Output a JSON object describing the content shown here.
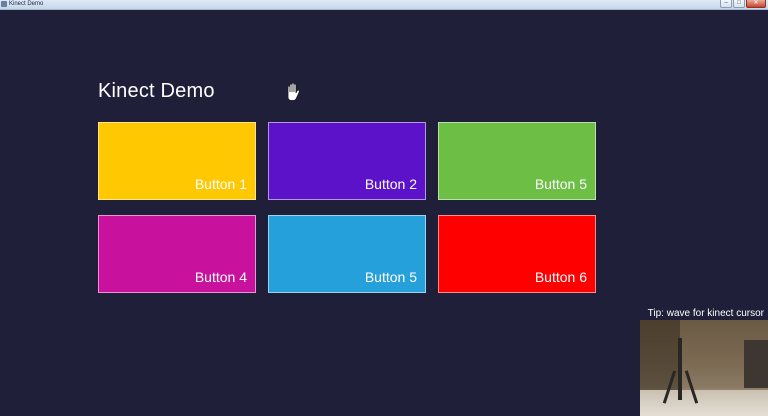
{
  "window": {
    "title": "Kinect Demo"
  },
  "page": {
    "title": "Kinect Demo"
  },
  "tiles": [
    {
      "label": "Button 1",
      "color": "#ffc800"
    },
    {
      "label": "Button 2",
      "color": "#5b12c8"
    },
    {
      "label": "Button 5",
      "color": "#6cbe45"
    },
    {
      "label": "Button 4",
      "color": "#c8129e"
    },
    {
      "label": "Button 5",
      "color": "#25a0da"
    },
    {
      "label": "Button 6",
      "color": "#ff0000"
    }
  ],
  "tip": "Tip: wave for kinect cursor",
  "icons": {
    "cursor": "hand-cursor-icon",
    "camera": "kinect-camera-feed"
  },
  "colors": {
    "background": "#201f3a"
  }
}
